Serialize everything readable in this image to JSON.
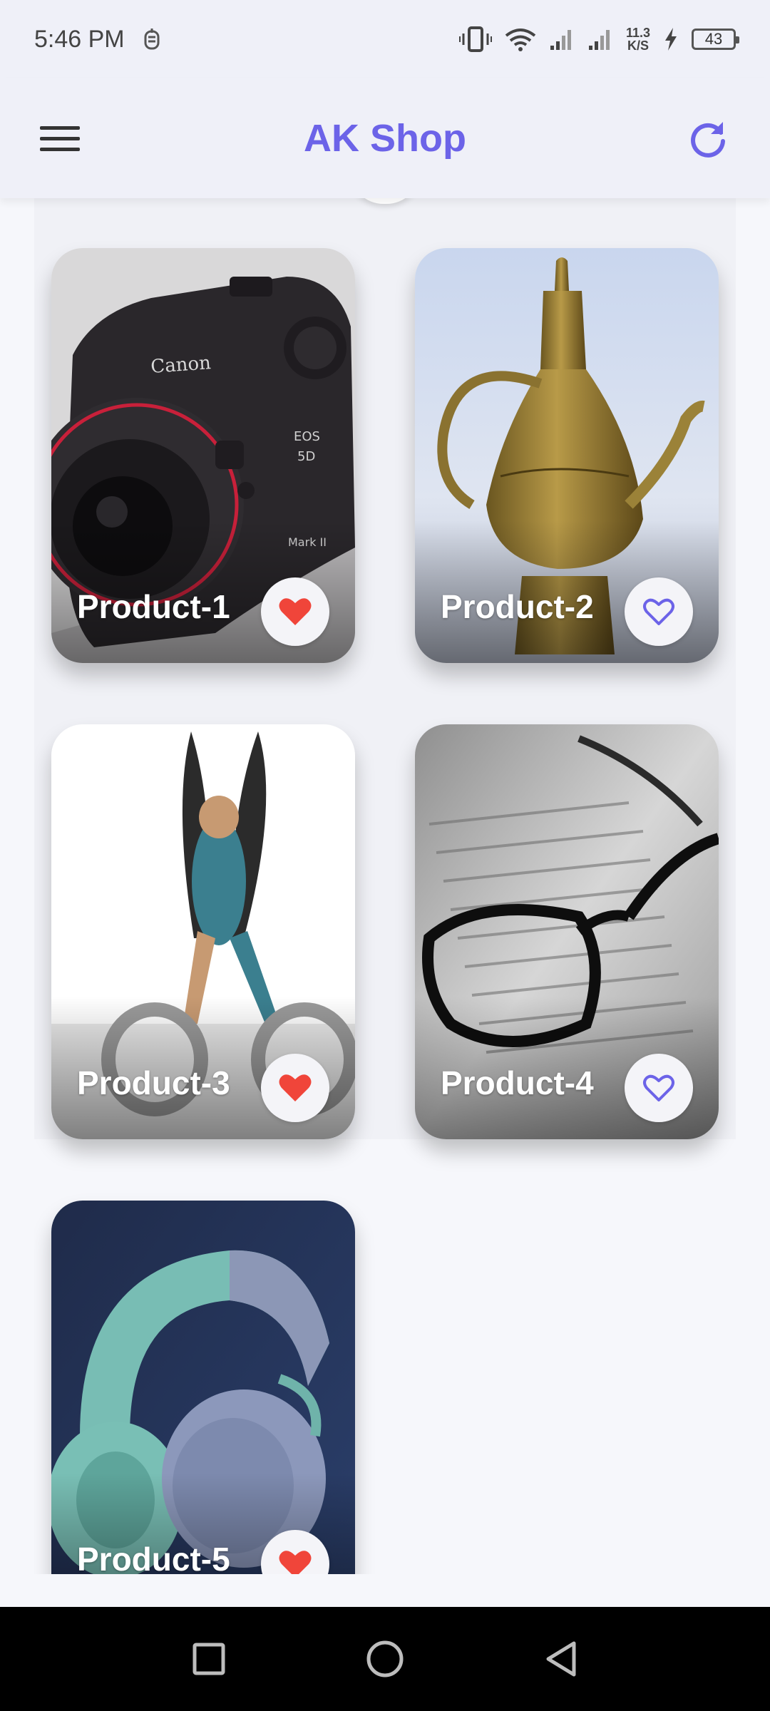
{
  "status_bar": {
    "time": "5:46 PM",
    "net_speed_value": "11.3",
    "net_speed_unit": "K/S",
    "battery_level": "43"
  },
  "app_bar": {
    "title": "AK Shop",
    "menu_icon": "hamburger-menu-icon",
    "refresh_icon": "refresh-icon"
  },
  "products": [
    {
      "name": "Product-1",
      "favorite": true,
      "image": "camera"
    },
    {
      "name": "Product-2",
      "favorite": false,
      "image": "brass-teapot"
    },
    {
      "name": "Product-3",
      "favorite": true,
      "image": "scissors-art"
    },
    {
      "name": "Product-4",
      "favorite": false,
      "image": "eyeglasses-on-newspaper"
    },
    {
      "name": "Product-5",
      "favorite": true,
      "image": "headphones"
    }
  ],
  "colors": {
    "accent": "#6c63e8",
    "favorite_active": "#f0453a",
    "app_bar_bg": "#eff0f8"
  },
  "nav_bar": {
    "recent_icon": "square-icon",
    "home_icon": "circle-icon",
    "back_icon": "triangle-back-icon"
  }
}
